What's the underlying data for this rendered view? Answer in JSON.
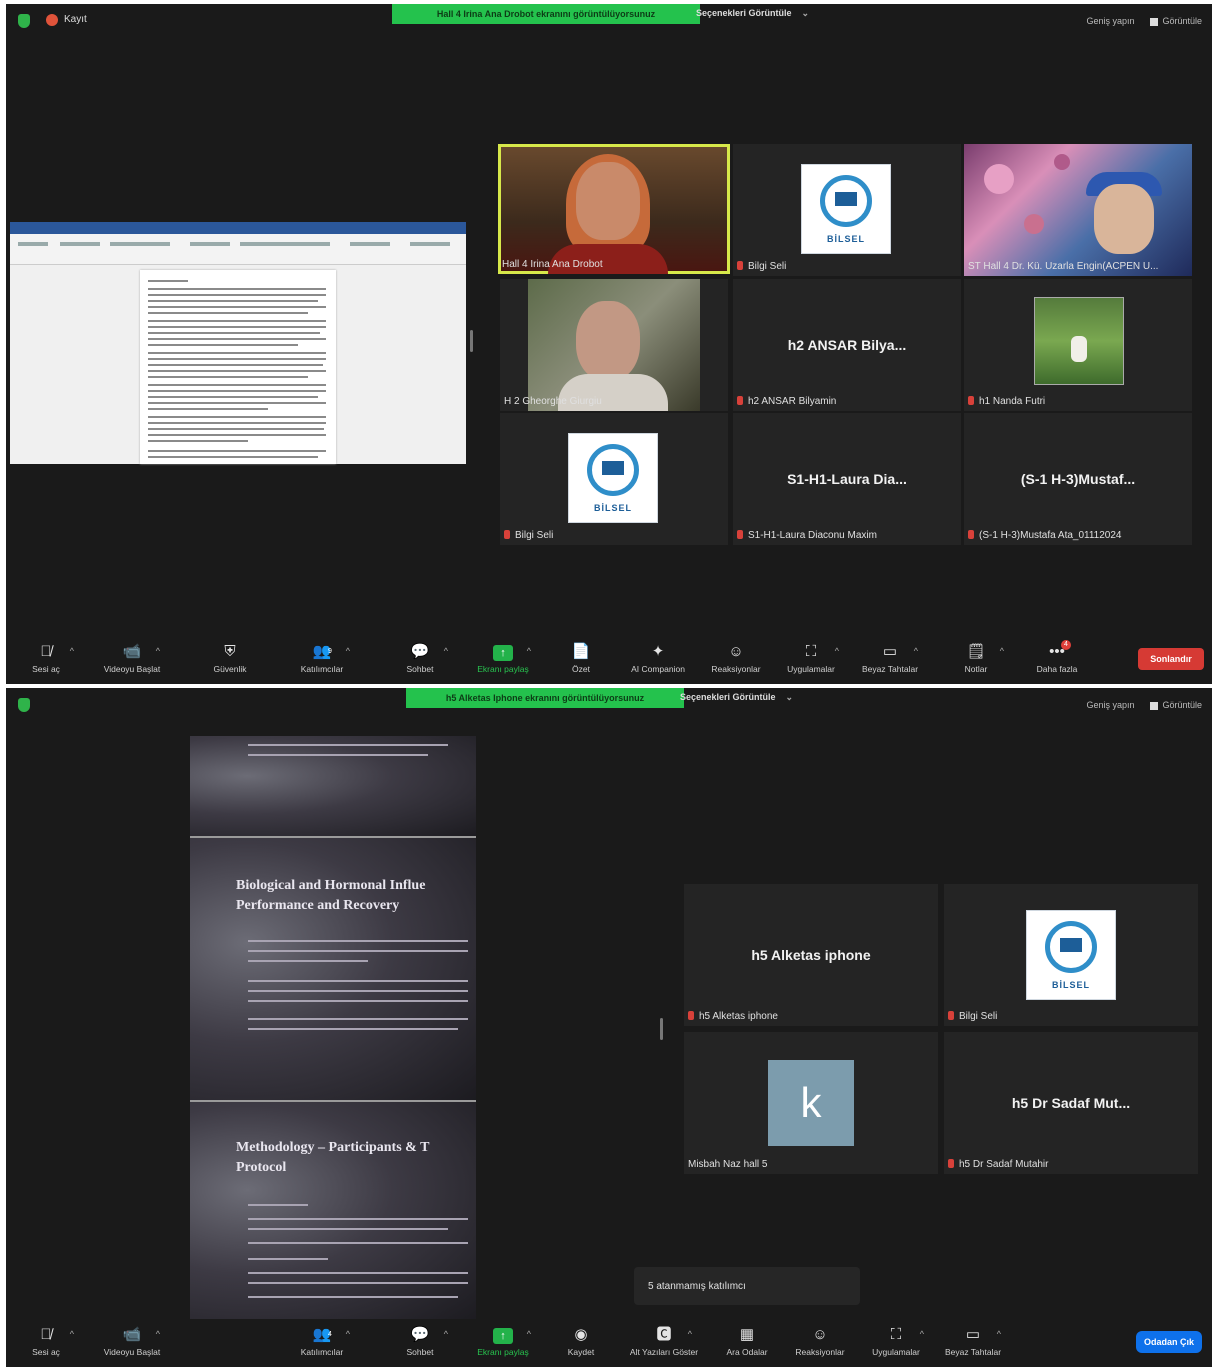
{
  "window1": {
    "top": {
      "record_label": "Kayıt",
      "share_banner": "Hall 4 Irina Ana Drobot ekranını görüntülüyorsunuz",
      "view_options": "Seçenekleri Görüntüle",
      "fullscreen": "Geniş yapın",
      "view": "Görüntüle"
    },
    "tiles": [
      {
        "label": "Hall 4 Irina Ana Drobot"
      },
      {
        "label": "Bilgi Seli"
      },
      {
        "label": "ST Hall 4 Dr. Kü. Uzarla Engin(ACPEN U..."
      },
      {
        "label": "H 2 Gheorghe Giurgiu"
      },
      {
        "name": "h2 ANSAR Bilya...",
        "label": "h2 ANSAR Bilyamin"
      },
      {
        "label": "h1 Nanda Futri"
      },
      {
        "label": "Bilgi Seli"
      },
      {
        "name": "S1-H1-Laura Dia...",
        "label": "S1-H1-Laura Diaconu Maxim"
      },
      {
        "name": "(S-1 H-3)Mustaf...",
        "label": "(S-1 H-3)Mustafa Ata_01112024"
      }
    ],
    "logo_text": "BİLSEL",
    "toolbar": {
      "mic": "Sesi aç",
      "video": "Videoyu Başlat",
      "security": "Güvenlik",
      "participants": "Katılımcılar",
      "participants_count": "9",
      "chat": "Sohbet",
      "share": "Ekranı paylaş",
      "summary": "Özet",
      "ai": "AI Companion",
      "reactions": "Reaksiyonlar",
      "apps": "Uygulamalar",
      "whiteboards": "Beyaz Tahtalar",
      "notes": "Notlar",
      "more": "Daha fazla",
      "more_badge": "4",
      "end": "Sonlandır"
    }
  },
  "window2": {
    "top": {
      "share_banner": "h5 Alketas Iphone ekranını görüntülüyorsunuz",
      "view_options": "Seçenekleri Görüntüle",
      "fullscreen": "Geniş yapın",
      "view": "Görüntüle"
    },
    "slide": {
      "title1": "Biological and Hormonal Influe",
      "title1b": "Performance and Recovery",
      "title2": "Methodology – Participants & T",
      "title2b": "Protocol"
    },
    "tiles": [
      {
        "name": "h5 Alketas iphone",
        "label": "h5 Alketas iphone"
      },
      {
        "label": "Bilgi Seli"
      },
      {
        "avatar": "k",
        "label": "Misbah Naz hall 5"
      },
      {
        "name": "h5 Dr Sadaf Mut...",
        "label": "h5 Dr Sadaf Mutahir"
      }
    ],
    "notice": "5 atanmamış katılımcı",
    "toolbar": {
      "mic": "Sesi aç",
      "video": "Videoyu Başlat",
      "participants": "Katılımcılar",
      "participants_count": "4",
      "chat": "Sohbet",
      "share": "Ekranı paylaş",
      "record": "Kaydet",
      "cc": "Alt Yazıları Göster",
      "breakout": "Ara Odalar",
      "reactions": "Reaksiyonlar",
      "apps": "Uygulamalar",
      "whiteboards": "Beyaz Tahtalar",
      "leave": "Odadan Çık"
    }
  }
}
